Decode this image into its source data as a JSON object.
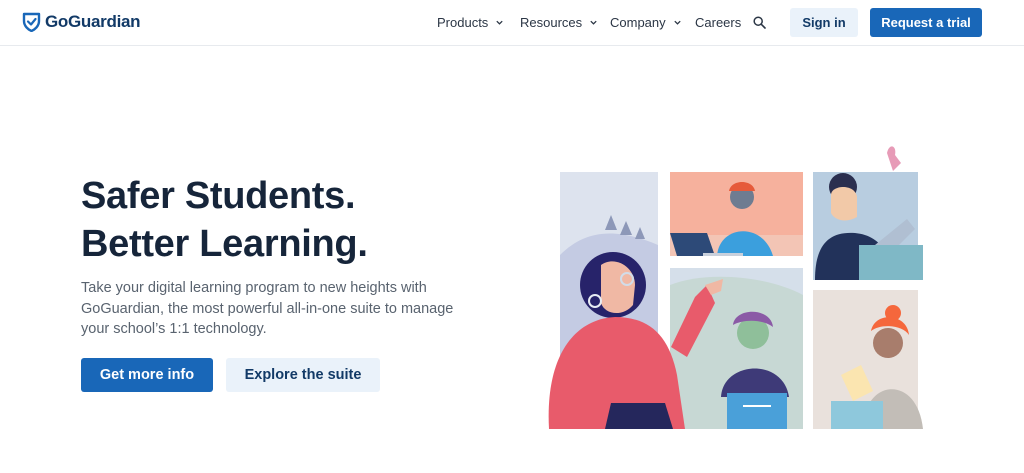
{
  "brand": {
    "name": "GoGuardian",
    "color": "#123a67",
    "shield_color": "#1967b8"
  },
  "nav": {
    "items": [
      {
        "label": "Products",
        "has_dropdown": true
      },
      {
        "label": "Resources",
        "has_dropdown": true
      },
      {
        "label": "Company",
        "has_dropdown": true
      },
      {
        "label": "Careers",
        "has_dropdown": false
      }
    ],
    "search_icon": "search-icon",
    "signin_label": "Sign in",
    "trial_label": "Request a trial"
  },
  "hero": {
    "title_line1": "Safer Students.",
    "title_line2": "Better Learning.",
    "subtitle": "Take your digital learning program to new heights with GoGuardian, the most powerful all-in-one suite to manage your school’s 1:1 technology.",
    "primary_button": "Get more info",
    "secondary_button": "Explore the suite"
  },
  "colors": {
    "primary": "#1967b8",
    "secondary_bg": "#eaf2fa",
    "heading": "#16253a",
    "body_text": "#59636f"
  }
}
